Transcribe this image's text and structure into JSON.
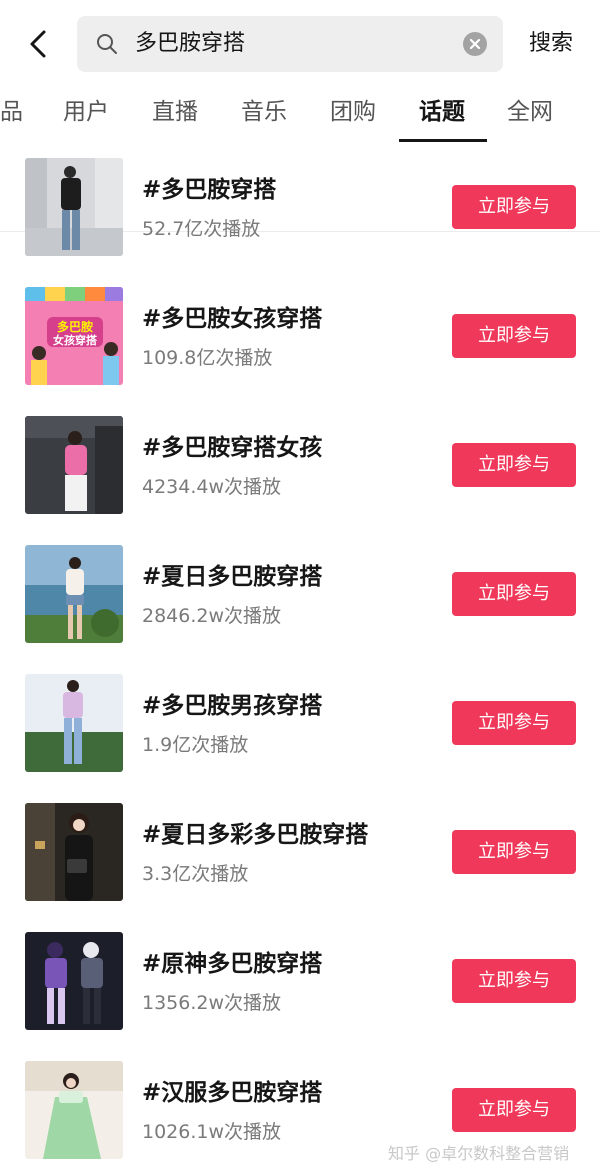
{
  "search": {
    "query": "多巴胺穿搭",
    "button_label": "搜索"
  },
  "tabs": [
    {
      "label": "品"
    },
    {
      "label": "用户"
    },
    {
      "label": "直播"
    },
    {
      "label": "音乐"
    },
    {
      "label": "团购"
    },
    {
      "label": "话题",
      "active": true
    },
    {
      "label": "全网"
    }
  ],
  "topics": [
    {
      "title": "#多巴胺穿搭",
      "plays": "52.7亿次播放",
      "action": "立即参与"
    },
    {
      "title": "#多巴胺女孩穿搭",
      "plays": "109.8亿次播放",
      "action": "立即参与",
      "thumb_text": "多巴胺\n女孩穿搭"
    },
    {
      "title": "#多巴胺穿搭女孩",
      "plays": "4234.4w次播放",
      "action": "立即参与"
    },
    {
      "title": "#夏日多巴胺穿搭",
      "plays": "2846.2w次播放",
      "action": "立即参与"
    },
    {
      "title": "#多巴胺男孩穿搭",
      "plays": "1.9亿次播放",
      "action": "立即参与"
    },
    {
      "title": "#夏日多彩多巴胺穿搭",
      "plays": "3.3亿次播放",
      "action": "立即参与"
    },
    {
      "title": "#原神多巴胺穿搭",
      "plays": "1356.2w次播放",
      "action": "立即参与"
    },
    {
      "title": "#汉服多巴胺穿搭",
      "plays": "1026.1w次播放",
      "action": "立即参与"
    }
  ],
  "watermark": "知乎 @卓尔数科整合营销",
  "colors": {
    "accent": "#f0395a",
    "search_bg": "#eeeeee",
    "secondary_text": "#7a7a7a"
  }
}
